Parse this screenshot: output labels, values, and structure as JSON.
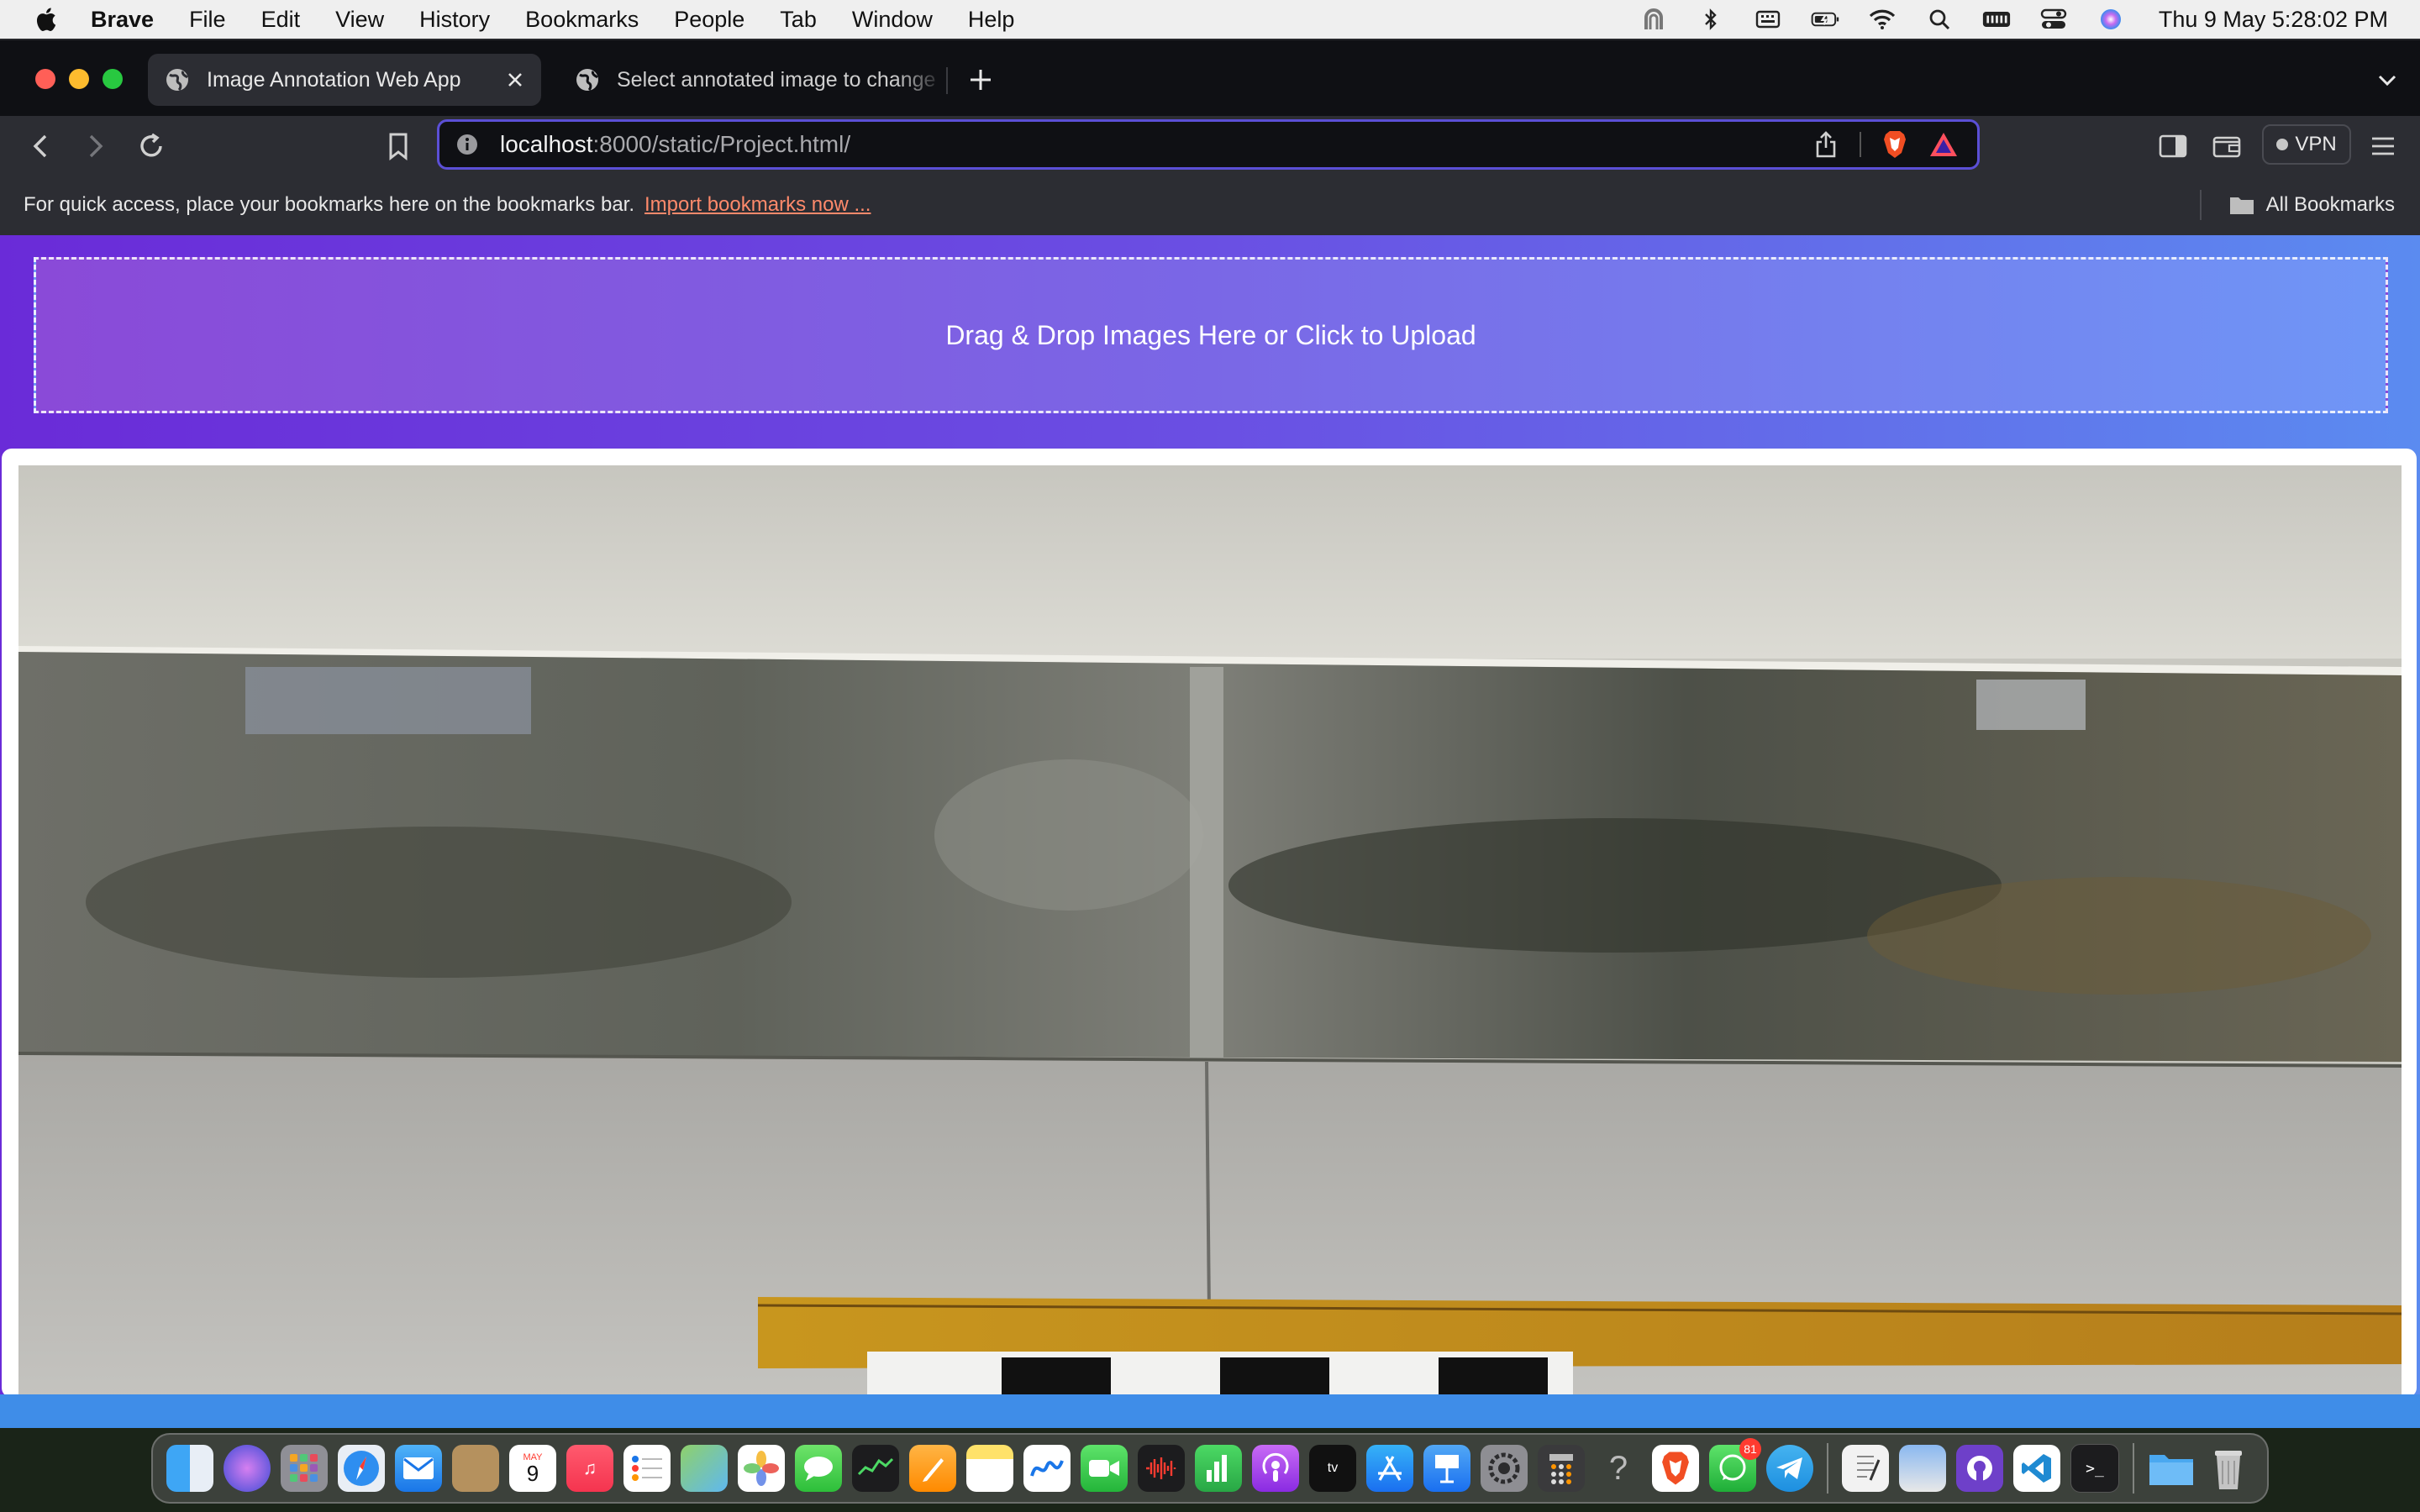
{
  "menubar": {
    "app_name": "Brave",
    "items": [
      "File",
      "Edit",
      "View",
      "History",
      "Bookmarks",
      "People",
      "Tab",
      "Window",
      "Help"
    ],
    "clock": "Thu 9 May  5:28:02 PM",
    "status_icons": [
      "airdrop-icon",
      "bluetooth-icon",
      "keyboard-icon",
      "battery-icon",
      "wifi-icon",
      "spotlight-icon",
      "input-icon",
      "control-center-icon",
      "siri-icon"
    ]
  },
  "browser": {
    "tabs": [
      {
        "title": "Image Annotation Web App",
        "active": true
      },
      {
        "title": "Select annotated image to change",
        "active": false
      }
    ],
    "url": {
      "host": "localhost",
      "rest": ":8000/static/Project.html/"
    },
    "vpn_label": "VPN",
    "bookmarks_bar": {
      "hint": "For quick access, place your bookmarks here on the bookmarks bar.",
      "import_link": "Import bookmarks now ...",
      "all_bookmarks": "All Bookmarks"
    }
  },
  "page": {
    "dropzone_text": "Drag & Drop Images Here or Click to Upload"
  },
  "dock": {
    "apps": [
      "finder",
      "siri",
      "launchpad",
      "safari",
      "mail",
      "contacts",
      "calendar",
      "music",
      "reminders",
      "maps",
      "photos",
      "messages",
      "stocks",
      "pages",
      "notes",
      "freeform",
      "facetime",
      "voice-memos",
      "numbers",
      "podcasts",
      "apple-tv",
      "app-store",
      "keynote",
      "system-settings",
      "calculator",
      "help",
      "brave",
      "whatsapp",
      "telegram"
    ],
    "apps_right": [
      "textedit",
      "preview",
      "github-desktop",
      "vscode",
      "terminal"
    ],
    "extras": [
      "downloads-folder",
      "trash"
    ],
    "calendar_month": "MAY",
    "calendar_day": "9",
    "whatsapp_badge": "81"
  },
  "colors": {
    "gradient_start": "#6a2bd8",
    "gradient_end": "#5b8bf0",
    "omnibox_border": "#5b4fd6",
    "link": "#ff8a6b"
  }
}
